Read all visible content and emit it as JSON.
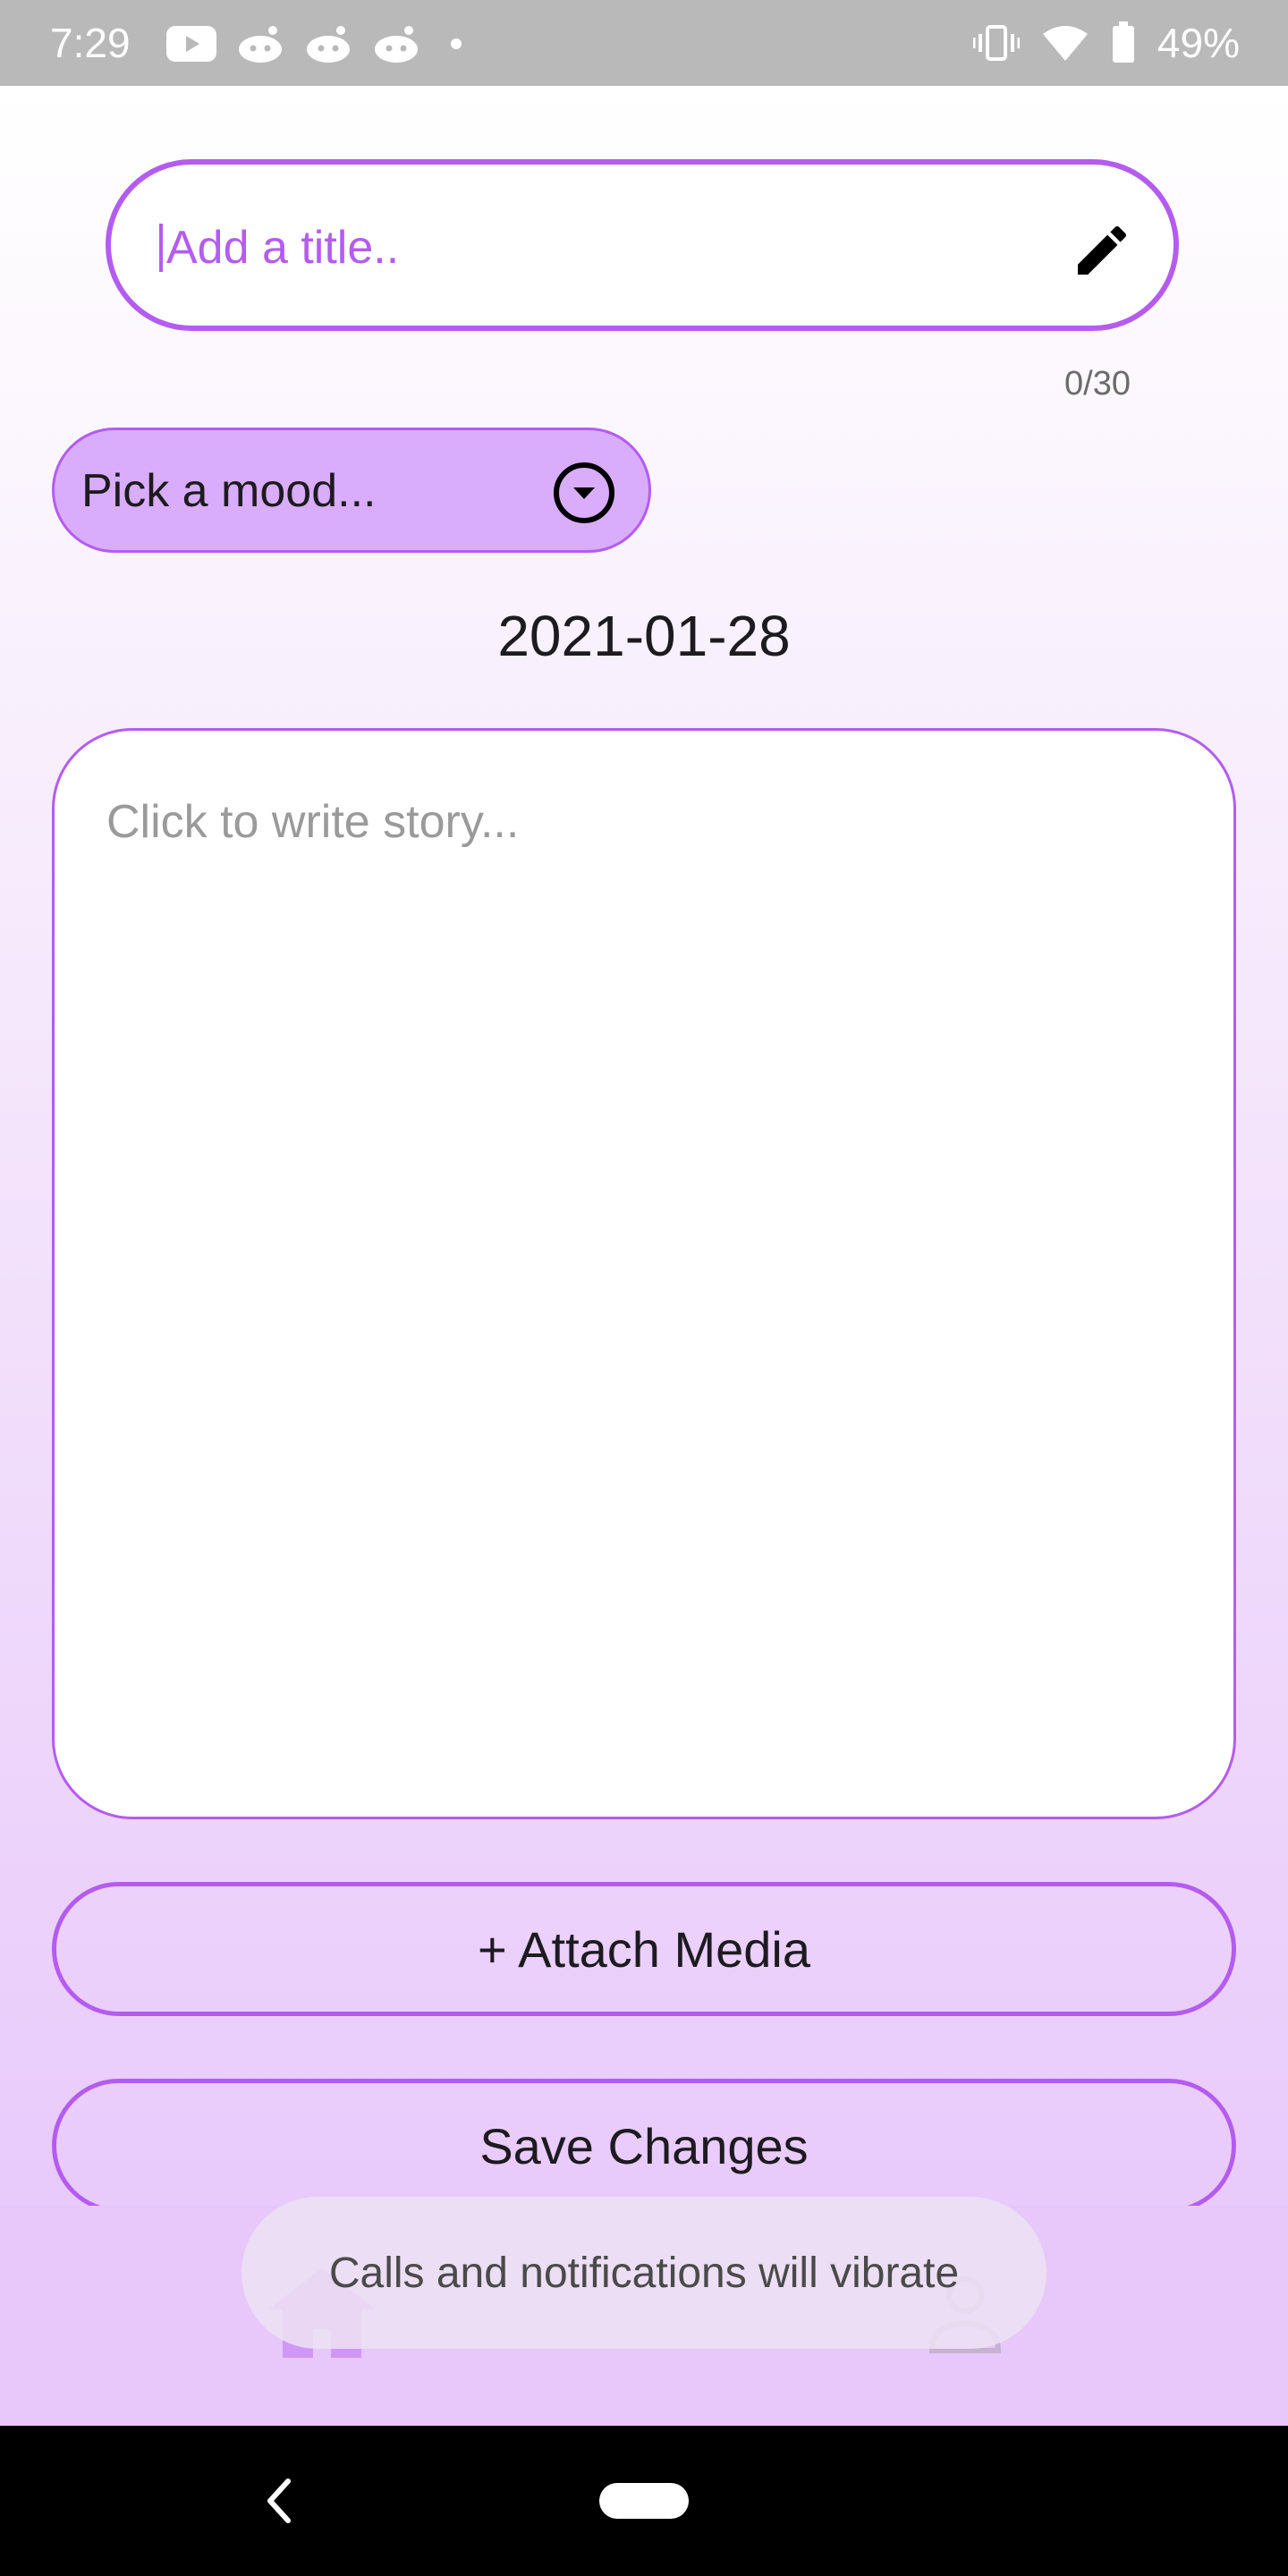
{
  "status_bar": {
    "time": "7:29",
    "notification_icons": [
      "youtube-icon",
      "reddit-icon",
      "reddit-icon",
      "reddit-icon",
      "dot-icon"
    ],
    "right_icons": [
      "vibrate-icon",
      "wifi-icon",
      "battery-icon"
    ],
    "battery_percent": "49%"
  },
  "title_field": {
    "value": "",
    "placeholder": "Add a title..",
    "icon": "pencil-icon",
    "counter": "0/30"
  },
  "mood_dropdown": {
    "label": "Pick a mood...",
    "icon": "dropdown-circle-icon"
  },
  "date": "2021-01-28",
  "story_field": {
    "value": "",
    "placeholder": "Click to write story..."
  },
  "buttons": {
    "attach_media": "+ Attach Media",
    "save_changes": "Save Changes"
  },
  "bottom_nav": {
    "icons": [
      "home-icon",
      "person-icon"
    ]
  },
  "toast": {
    "text": "Calls and notifications will vibrate"
  },
  "colors": {
    "accent": "#b45cf0",
    "mood_fill": "#d9adfb",
    "status_bar": "#b9b9b9",
    "nav_bar": "#000000"
  }
}
